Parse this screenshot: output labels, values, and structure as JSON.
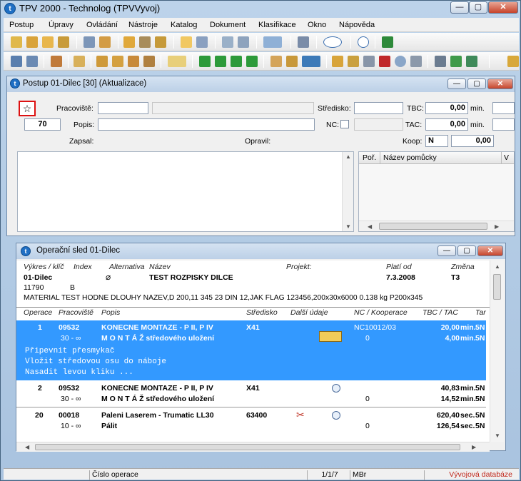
{
  "window": {
    "title": "TPV 2000 - Technolog (TPVVyvoj)",
    "app_icon": "t"
  },
  "menu": [
    "Postup",
    "Úpravy",
    "Ovládání",
    "Nástroje",
    "Katalog",
    "Dokument",
    "Klasifikace",
    "Okno",
    "Nápověda"
  ],
  "postup": {
    "title": "Postup 01-Dilec  [30] (Aktualizace)",
    "labels": {
      "pracoviste": "Pracoviště:",
      "stredisko": "Středisko:",
      "tbc": "TBC:",
      "min1": "min.",
      "popis": "Popis:",
      "nc": "NC:",
      "tac": "TAC:",
      "min2": "min.",
      "zapsal": "Zapsal:",
      "opravil": "Opravil:",
      "koop": "Koop:"
    },
    "values": {
      "seq": "70",
      "tbc": "0,00",
      "tac": "0,00",
      "koop": "N",
      "koop_val": "0,00"
    },
    "tools_header": {
      "por": "Poř.",
      "nazev": "Název pomůcky",
      "v": "V"
    }
  },
  "opsled": {
    "title": "Operační sled 01-Dilec",
    "head_labels": {
      "vykres": "Výkres / klíč",
      "index": "Index",
      "alternativa": "Alternativa",
      "nazev": "Název",
      "projekt": "Projekt:",
      "platiod": "Platí od",
      "zmena": "Změna"
    },
    "head_values": {
      "dilec": "01-Dilec",
      "nazev": "TEST ROZPISKY DILCE",
      "platiod": "7.3.2008",
      "zmena": "T3",
      "cislo": "11790",
      "index": "B"
    },
    "material": "MATERIAL TEST HODNE DLOUHY NAZEV,D 200,11 345 23 DIN 12,JAK FLAG 123456,200x30x6000 0.138 kg P200x345",
    "columns": [
      "Operace",
      "Pracoviště",
      "Popis",
      "Středisko",
      "Další údaje",
      "NC / Kooperace",
      "TBC / TAC",
      "Tar"
    ],
    "rows": [
      {
        "op": "1",
        "prac": "09532",
        "sub": "30 - ∞",
        "popis": "KONECNE MONTAZE - P II, P IV",
        "popis2": "M O N T Á Ž středového uložení",
        "stred": "X41",
        "nc": "NC10012/03",
        "nc2": "0",
        "tbc": "20,00",
        "u1": "min.",
        "tac": "4,00",
        "u2": "min.",
        "t1": "5N",
        "t2": "5N",
        "note": [
          "Připevnit přesmykač",
          "Vložit středovou osu do náboje",
          "Nasadit levou kliku ..."
        ]
      },
      {
        "op": "2",
        "prac": "09532",
        "sub": "30 - ∞",
        "popis": "KONECNE MONTAZE - P II, P IV",
        "popis2": "M O N T Á Ž středového uložení",
        "stred": "X41",
        "nc": "",
        "nc2": "0",
        "tbc": "40,83",
        "u1": "min.",
        "tac": "14,52",
        "u2": "min.",
        "t1": "5N",
        "t2": "5N"
      },
      {
        "op": "20",
        "prac": "00018",
        "sub": "10 - ∞",
        "popis": "Paleni Laserem - Trumatic LL30",
        "popis2": "Pálit",
        "stred": "63400",
        "nc": "",
        "nc2": "0",
        "tbc": "620,40",
        "u1": "sec.",
        "tac": "126,54",
        "u2": "sec.",
        "t1": "5N",
        "t2": "5N"
      }
    ]
  },
  "status": {
    "field": "Číslo operace",
    "pos": "1/1/7",
    "unit": "MBr",
    "db": "Vývojová databáze"
  }
}
